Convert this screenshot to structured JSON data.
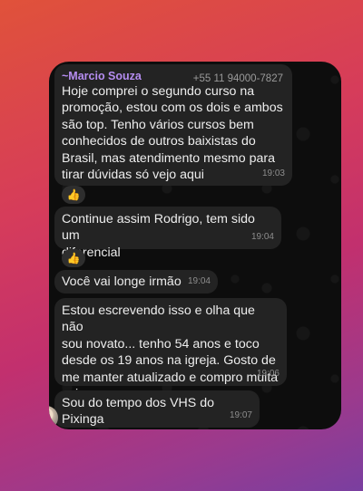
{
  "chat": {
    "sender_name": "~Marcio Souza",
    "sender_phone": "+55 11 94000-7827",
    "messages": [
      {
        "text": "Hoje comprei o segundo curso na\npromoção, estou com os dois e ambos\nsão top. Tenho vários cursos bem\nconhecidos de outros baixistas do\nBrasil, mas atendimento mesmo para\ntirar dúvidas só vejo aqui",
        "time": "19:03",
        "reaction": "👍"
      },
      {
        "text": "Continue assim Rodrigo, tem sido um\ndiferencial",
        "time": "19:04",
        "reaction": "👍"
      },
      {
        "text": "Você vai longe irmão",
        "time": "19:04"
      },
      {
        "text": "Estou escrevendo isso e olha que não\nsou novato... tenho 54 anos e toco\ndesde os 19 anos na igreja. Gosto de\nme manter atualizado e compro muita\ncoisa mesmo",
        "time": "19:06"
      },
      {
        "text": "Sou do tempo dos VHS do Pixinga",
        "time": "19:07"
      }
    ]
  },
  "colors": {
    "bubble": "#232323",
    "sender": "#b58df0",
    "background": "#0d0d0d"
  }
}
